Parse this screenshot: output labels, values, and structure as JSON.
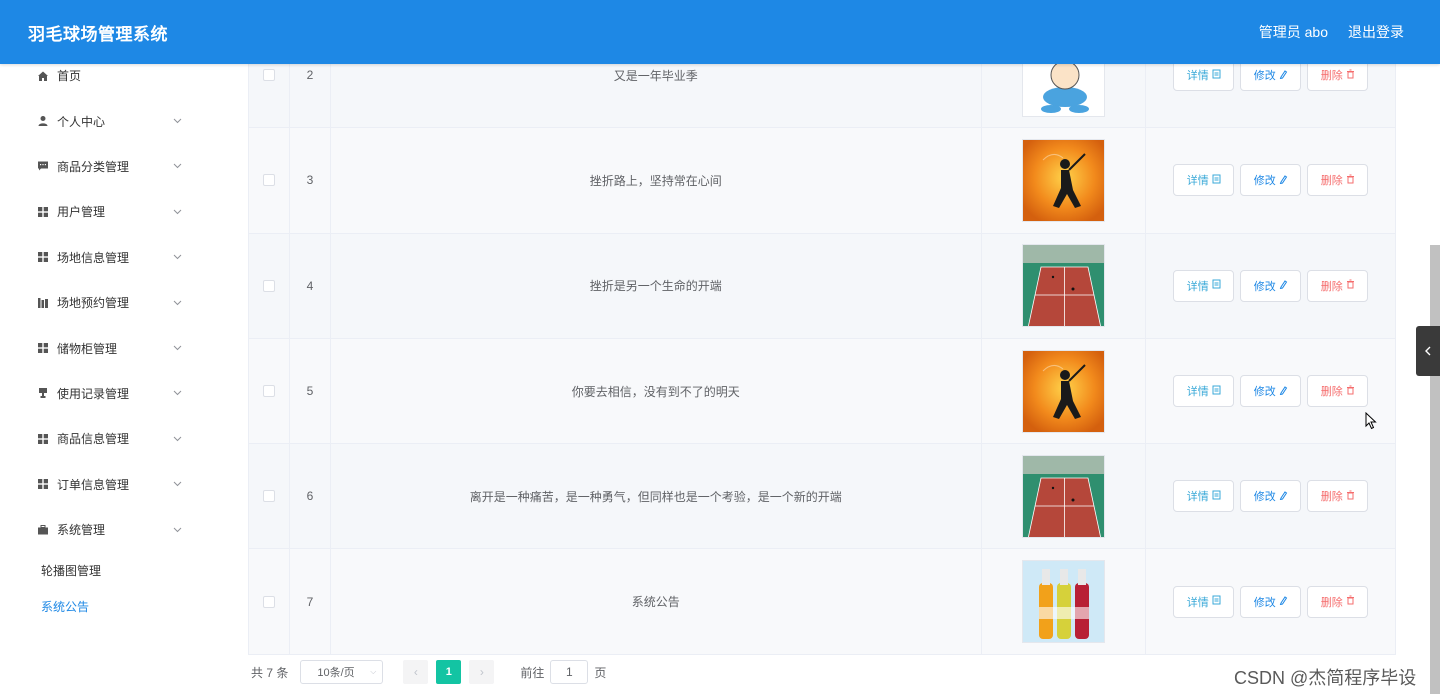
{
  "header": {
    "brand": "羽毛球场管理系统",
    "user": "管理员 abo",
    "logout": "退出登录"
  },
  "sidebar": {
    "items": [
      {
        "label": "首页",
        "icon": "home-icon",
        "expandable": false
      },
      {
        "label": "个人中心",
        "icon": "user-icon",
        "expandable": true
      },
      {
        "label": "商品分类管理",
        "icon": "chat-icon",
        "expandable": true
      },
      {
        "label": "用户管理",
        "icon": "grid-icon",
        "expandable": true
      },
      {
        "label": "场地信息管理",
        "icon": "grid-icon",
        "expandable": true
      },
      {
        "label": "场地预约管理",
        "icon": "chart-icon",
        "expandable": true
      },
      {
        "label": "储物柜管理",
        "icon": "grid-icon",
        "expandable": true
      },
      {
        "label": "使用记录管理",
        "icon": "stamp-icon",
        "expandable": true
      },
      {
        "label": "商品信息管理",
        "icon": "grid-icon",
        "expandable": true
      },
      {
        "label": "订单信息管理",
        "icon": "grid-icon",
        "expandable": true
      },
      {
        "label": "系统管理",
        "icon": "briefcase-icon",
        "expandable": true
      }
    ],
    "sub_items": [
      {
        "label": "轮播图管理",
        "active": false
      },
      {
        "label": "系统公告",
        "active": true
      }
    ]
  },
  "table": {
    "rows": [
      {
        "index": "2",
        "title": "又是一年毕业季",
        "image": "cartoon"
      },
      {
        "index": "3",
        "title": "挫折路上，坚持常在心间",
        "image": "orange"
      },
      {
        "index": "4",
        "title": "挫折是另一个生命的开端",
        "image": "court"
      },
      {
        "index": "5",
        "title": "你要去相信，没有到不了的明天",
        "image": "orange"
      },
      {
        "index": "6",
        "title": "离开是一种痛苦，是一种勇气，但同样也是一个考验，是一个新的开端",
        "image": "court"
      },
      {
        "index": "7",
        "title": "系统公告",
        "image": "bottles"
      }
    ],
    "actions": {
      "detail": "详情",
      "edit": "修改",
      "delete": "删除"
    }
  },
  "pagination": {
    "total": "共 7 条",
    "page_size": "10条/页",
    "current_page": "1",
    "goto_label": "前往",
    "goto_value": "1",
    "page_suffix": "页"
  },
  "watermark": "CSDN @杰简程序毕设",
  "colors": {
    "header": "#1e88e5",
    "active_page": "#13c4a3",
    "delete": "#f56c6c"
  }
}
